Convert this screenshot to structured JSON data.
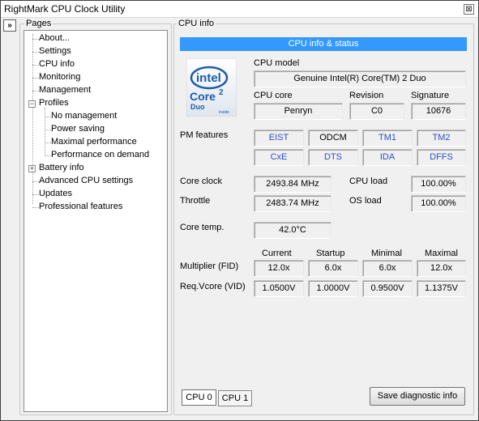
{
  "window": {
    "title": "RightMark CPU Clock Utility",
    "close_glyph": "⊠"
  },
  "collapse_glyph": "»",
  "pages": {
    "label": "Pages",
    "items": [
      {
        "label": "About..."
      },
      {
        "label": "Settings"
      },
      {
        "label": "CPU info"
      },
      {
        "label": "Monitoring"
      },
      {
        "label": "Management"
      },
      {
        "label": "Profiles",
        "expander": "−"
      },
      {
        "label": "No management"
      },
      {
        "label": "Power saving"
      },
      {
        "label": "Maximal performance"
      },
      {
        "label": "Performance on demand"
      },
      {
        "label": "Battery info",
        "expander": "+"
      },
      {
        "label": "Advanced CPU settings"
      },
      {
        "label": "Updates"
      },
      {
        "label": "Professional features"
      }
    ]
  },
  "cpu_info": {
    "group_label": "CPU info",
    "banner": "CPU info & status",
    "logo": {
      "brand": "intel",
      "line1": "Core",
      "sup": "2",
      "line2": "Duo",
      "tag": "inside"
    },
    "model_label": "CPU model",
    "model_value": "Genuine Intel(R) Core(TM) 2 Duo",
    "core_label": "CPU core",
    "core_value": "Penryn",
    "revision_label": "Revision",
    "revision_value": "C0",
    "signature_label": "Signature",
    "signature_value": "10676",
    "pm_label": "PM features",
    "pm_features": [
      "EIST",
      "ODCM",
      "TM1",
      "TM2",
      "CxE",
      "DTS",
      "IDA",
      "DFFS"
    ],
    "core_clock_label": "Core clock",
    "core_clock_value": "2493.84 MHz",
    "throttle_label": "Throttle",
    "throttle_value": "2483.74 MHz",
    "cpu_load_label": "CPU load",
    "cpu_load_value": "100.00%",
    "os_load_label": "OS load",
    "os_load_value": "100.00%",
    "core_temp_label": "Core temp.",
    "core_temp_value": "42.0°C",
    "table": {
      "headers": [
        "Current",
        "Startup",
        "Minimal",
        "Maximal"
      ],
      "multiplier_label": "Multiplier (FID)",
      "multiplier_values": [
        "12.0x",
        "6.0x",
        "6.0x",
        "12.0x"
      ],
      "vcore_label": "Req.Vcore (VID)",
      "vcore_values": [
        "1.0500V",
        "1.0000V",
        "0.9500V",
        "1.1375V"
      ]
    },
    "tabs": [
      "CPU 0",
      "CPU 1"
    ],
    "save_button": "Save diagnostic info"
  },
  "colors": {
    "accent": "#3399ff",
    "feature_text": "#2a4fc7"
  }
}
